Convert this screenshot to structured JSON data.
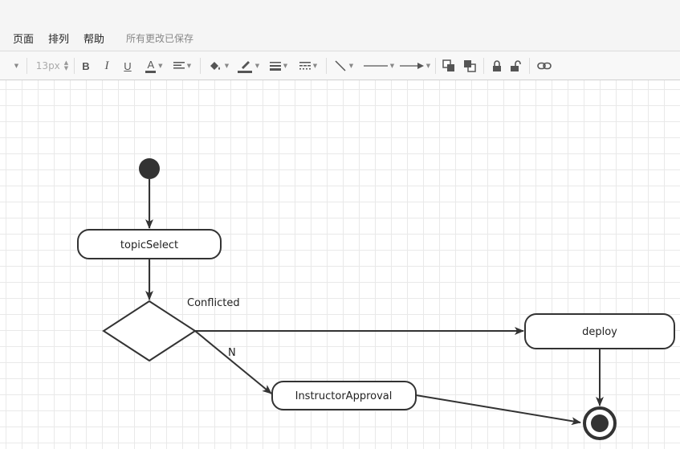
{
  "menu": {
    "items": [
      "页面",
      "排列",
      "帮助"
    ],
    "save_status": "所有更改已保存"
  },
  "toolbar": {
    "font_size": "13px",
    "bold_label": "B",
    "italic_label": "I",
    "underline_label": "U",
    "font_color_label": "A",
    "icons": [
      "font-size-stepper",
      "bold-icon",
      "italic-icon",
      "underline-icon",
      "font-color-icon",
      "text-align-icon",
      "fill-color-icon",
      "line-color-icon",
      "line-width-icon",
      "line-style-icon",
      "connector-style-icon",
      "line-type-icon",
      "arrow-style-icon",
      "bring-to-front-icon",
      "send-to-back-icon",
      "lock-icon",
      "unlock-icon",
      "link-icon"
    ]
  },
  "diagram": {
    "nodes": {
      "start": {
        "type": "initial",
        "label": ""
      },
      "topic_select": {
        "type": "action",
        "label": "topicSelect"
      },
      "decision": {
        "type": "decision",
        "label": ""
      },
      "deploy": {
        "type": "action",
        "label": "deploy"
      },
      "instructor_approval": {
        "type": "action",
        "label": "InstructorApproval"
      },
      "end": {
        "type": "final",
        "label": ""
      }
    },
    "edges": [
      {
        "from": "start",
        "to": "topic_select",
        "label": ""
      },
      {
        "from": "topic_select",
        "to": "decision",
        "label": ""
      },
      {
        "from": "decision",
        "to": "deploy",
        "label": "Conflicted"
      },
      {
        "from": "decision",
        "to": "instructor_approval",
        "label": "N"
      },
      {
        "from": "deploy",
        "to": "end",
        "label": ""
      },
      {
        "from": "instructor_approval",
        "to": "end",
        "label": ""
      }
    ],
    "colors": {
      "stroke": "#333333",
      "fill": "#ffffff",
      "grid": "#e9e9e9"
    }
  }
}
